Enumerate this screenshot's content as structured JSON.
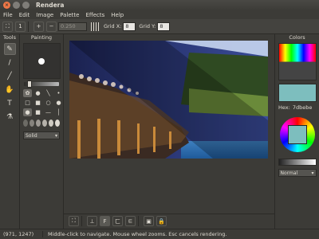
{
  "window": {
    "title": "Rendera"
  },
  "menu": [
    "File",
    "Edit",
    "Image",
    "Palette",
    "Effects",
    "Help"
  ],
  "toolbar": {
    "zoom_value": "0.250",
    "grid_x_label": "Grid X:",
    "grid_x_value": "8",
    "grid_y_label": "Grid Y:",
    "grid_y_value": "8"
  },
  "tools_panel": {
    "title": "Tools",
    "tools": [
      "paint-brush-icon",
      "pencil-icon",
      "line-icon",
      "hand-icon",
      "text-icon",
      "eyedropper-icon"
    ]
  },
  "painting_panel": {
    "title": "Painting",
    "mode": "Solid"
  },
  "colors_panel": {
    "title": "Colors",
    "hex_label": "Hex:",
    "hex_value": "7dbebe",
    "blend_mode": "Normal"
  },
  "status": {
    "coords": "(971, 1247)",
    "message": "Middle-click to navigate. Mouse wheel zooms. Esc cancels rendering."
  }
}
